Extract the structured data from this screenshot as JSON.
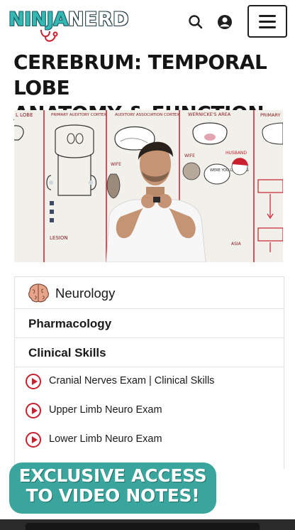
{
  "header": {
    "logo_part1": "NINJA",
    "logo_part2": "NERD",
    "search_icon": "search-icon",
    "account_icon": "user-circle-icon",
    "menu_icon": "hamburger-menu-icon"
  },
  "page": {
    "title_line1": "CEREBRUM: TEMPORAL LOBE",
    "title_line2": "ANATOMY & FUNCTION"
  },
  "video": {
    "board_labels": [
      "L LOBE",
      "PRIMARY AUDITORY CORTEX",
      "AUDITORY ASSOCIATION CORTEX",
      "WERNICKE'S AREA",
      "PRIMARY"
    ],
    "doodle_texts": [
      "WIFE",
      "HUSBAND",
      "WERE YOU LISTENING",
      "LESION",
      "WIFE",
      "ASIA"
    ]
  },
  "course_list": {
    "category": "Neurology",
    "category_icon": "brain-icon",
    "sections": [
      "Pharmacology",
      "Clinical Skills"
    ],
    "lessons": [
      "Cranial Nerves Exam | Clinical Skills",
      "Upper Limb Neuro Exam",
      "Lower Limb Neuro Exam"
    ]
  },
  "promo": {
    "line1": "EXCLUSIVE ACCESS",
    "line2": "TO VIDEO NOTES!"
  },
  "colors": {
    "brand_teal": "#35b8b2",
    "promo_teal": "#3aa59c",
    "play_red": "#c8202f",
    "text_dark": "#151515"
  }
}
